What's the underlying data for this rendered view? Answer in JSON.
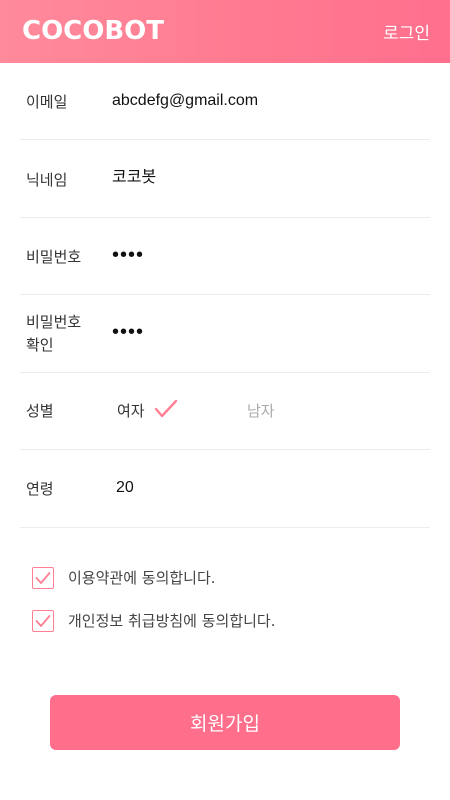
{
  "header": {
    "logo": "COCOBOT",
    "login_label": "로그인"
  },
  "form": {
    "email": {
      "label": "이메일",
      "value": "abcdefg@gmail.com"
    },
    "nickname": {
      "label": "닉네임",
      "value": "코코봇"
    },
    "password": {
      "label": "비밀번호",
      "value": "••••"
    },
    "password_confirm": {
      "label_line1": "비밀번호",
      "label_line2": "확인",
      "value": "••••"
    },
    "gender": {
      "label": "성별",
      "options": [
        "여자",
        "남자"
      ],
      "selected": "여자"
    },
    "age": {
      "label": "연령",
      "value": "20"
    }
  },
  "agreements": [
    {
      "text": "이용약관에 동의합니다.",
      "checked": true
    },
    {
      "text": "개인정보 취급방침에 동의합니다.",
      "checked": true
    }
  ],
  "submit_label": "회원가입",
  "colors": {
    "accent": "#ff6e8a",
    "header_gradient_start": "#ff8a9b",
    "header_gradient_end": "#ff6f8e",
    "checkmark": "#ff7f95"
  }
}
